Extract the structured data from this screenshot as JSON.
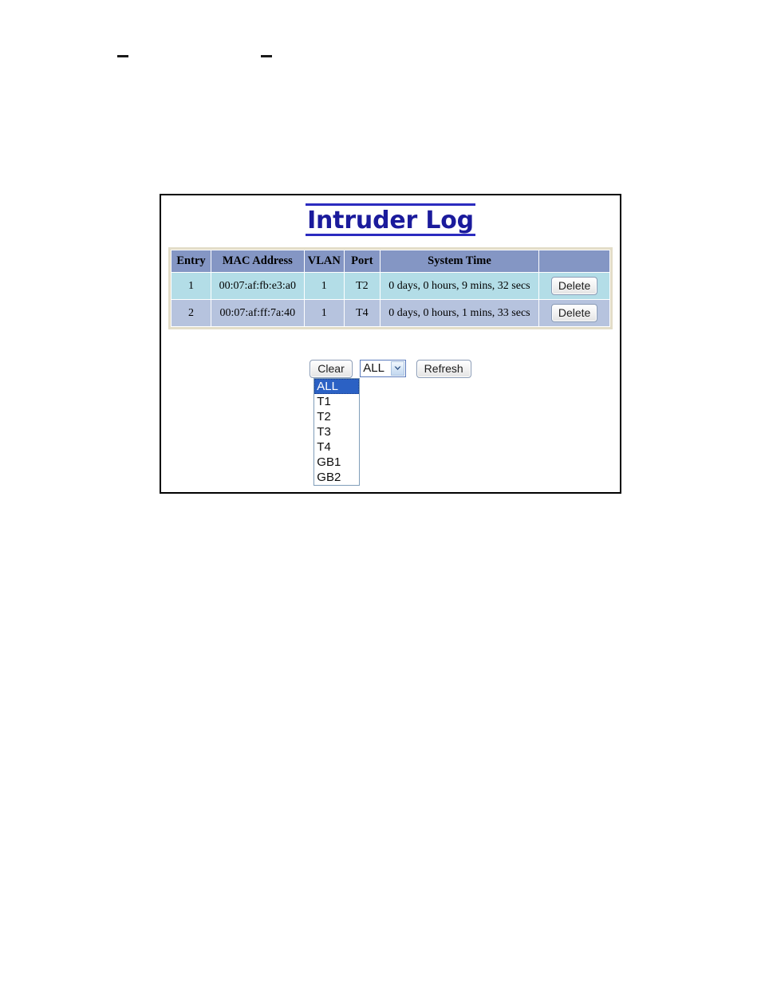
{
  "page": {
    "top_marks": [
      "—",
      "—"
    ]
  },
  "app": {
    "title": "Intruder Log",
    "table": {
      "columns": [
        "Entry",
        "MAC Address",
        "VLAN",
        "Port",
        "System Time",
        ""
      ],
      "rows": [
        {
          "entry": "1",
          "mac_address": "00:07:af:fb:e3:a0",
          "vlan": "1",
          "port": "T2",
          "system_time": "0 days, 0 hours, 9 mins, 32 secs",
          "action_label": "Delete"
        },
        {
          "entry": "2",
          "mac_address": "00:07:af:ff:7a:40",
          "vlan": "1",
          "port": "T4",
          "system_time": "0 days, 0 hours, 1 mins, 33 secs",
          "action_label": "Delete"
        }
      ]
    },
    "controls": {
      "clear_label": "Clear",
      "refresh_label": "Refresh",
      "port_filter": {
        "selected": "ALL",
        "expanded": true,
        "options": [
          "ALL",
          "T1",
          "T2",
          "T3",
          "T4",
          "GB1",
          "GB2"
        ]
      }
    }
  },
  "colors": {
    "title_text": "#1b1b9c",
    "title_rule": "#2b2bbf",
    "table_header_bg": "#8496c4",
    "row_odd_bg": "#b3dde7",
    "row_even_bg": "#b6c3de",
    "table_outer_border": "#e3ddc8",
    "frame_border": "#000000",
    "option_selected_bg": "#2b61c4"
  }
}
